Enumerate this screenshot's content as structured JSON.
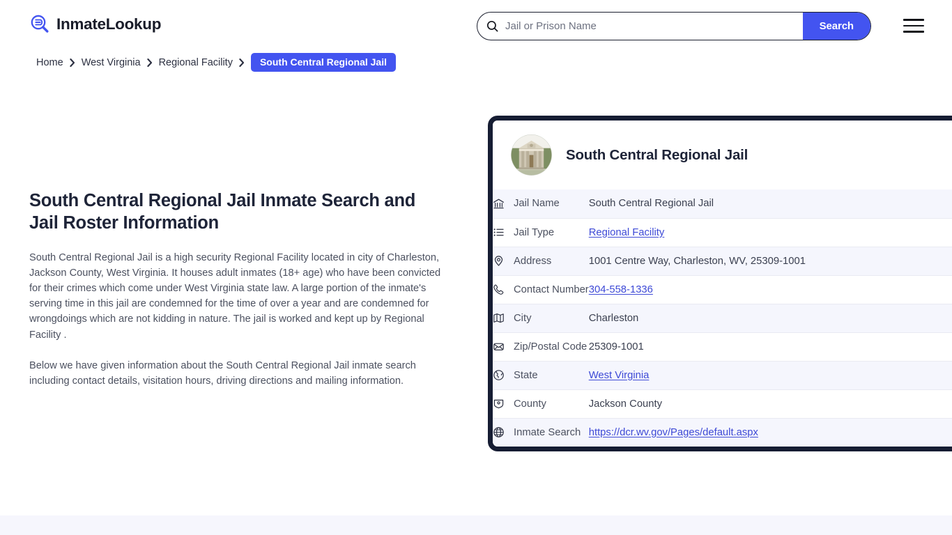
{
  "header": {
    "brand_name": "InmateLookup",
    "brand_icon": "magnifier-list-icon",
    "menu_icon": "hamburger-menu-icon",
    "search": {
      "icon": "search-icon",
      "placeholder": "Jail or Prison Name",
      "value": "",
      "button_label": "Search"
    }
  },
  "breadcrumb": {
    "items": [
      {
        "label": "Home",
        "current": false
      },
      {
        "label": "West Virginia",
        "current": false
      },
      {
        "label": "Regional Facility",
        "current": false
      },
      {
        "label": "South Central Regional Jail",
        "current": true
      }
    ],
    "separator_icon": "chevron-right-icon"
  },
  "main": {
    "page_title": "South Central Regional Jail Inmate Search and Jail Roster Information",
    "paragraph_1": "South Central Regional Jail is a high security Regional Facility located in city of Charleston, Jackson County, West Virginia. It houses adult inmates (18+ age) who have been convicted for their crimes which come under West Virginia state law. A large portion of the inmate's serving time in this jail are condemned for the time of over a year and are condemned for wrongdoings which are not kidding in nature. The jail is worked and kept up by Regional Facility .",
    "paragraph_2": "Below we have given information about the South Central Regional Jail inmate search including contact details, visitation hours, driving directions and mailing information."
  },
  "info_card": {
    "avatar_icon": "jail-building-photo",
    "title": "South Central Regional Jail",
    "rows": [
      {
        "icon": "bank-building-icon",
        "label": "Jail Name",
        "value": "South Central Regional Jail",
        "link": false
      },
      {
        "icon": "list-icon",
        "label": "Jail Type",
        "value": "Regional Facility",
        "link": true
      },
      {
        "icon": "map-pin-icon",
        "label": "Address",
        "value": "1001 Centre Way, Charleston, WV, 25309-1001",
        "link": false
      },
      {
        "icon": "phone-icon",
        "label": "Contact Number",
        "value": "304-558-1336",
        "link": true
      },
      {
        "icon": "map-folded-icon",
        "label": "City",
        "value": "Charleston",
        "link": false
      },
      {
        "icon": "envelope-open-icon",
        "label": "Zip/Postal Code",
        "value": "25309-1001",
        "link": false
      },
      {
        "icon": "globe-americas-icon",
        "label": "State",
        "value": "West Virginia",
        "link": true
      },
      {
        "icon": "badge-icon",
        "label": "County",
        "value": "Jackson County",
        "link": false
      },
      {
        "icon": "globe-grid-icon",
        "label": "Inmate Search",
        "value": "https://dcr.wv.gov/Pages/default.aspx",
        "link": true
      }
    ]
  },
  "colors": {
    "accent": "#4354f0",
    "card_border": "#161d33",
    "link": "#3d49d6",
    "row_alt": "#f5f6fd",
    "footer_band": "#f6f6fd",
    "heading": "#1e2438",
    "body_text": "#4c5160"
  }
}
